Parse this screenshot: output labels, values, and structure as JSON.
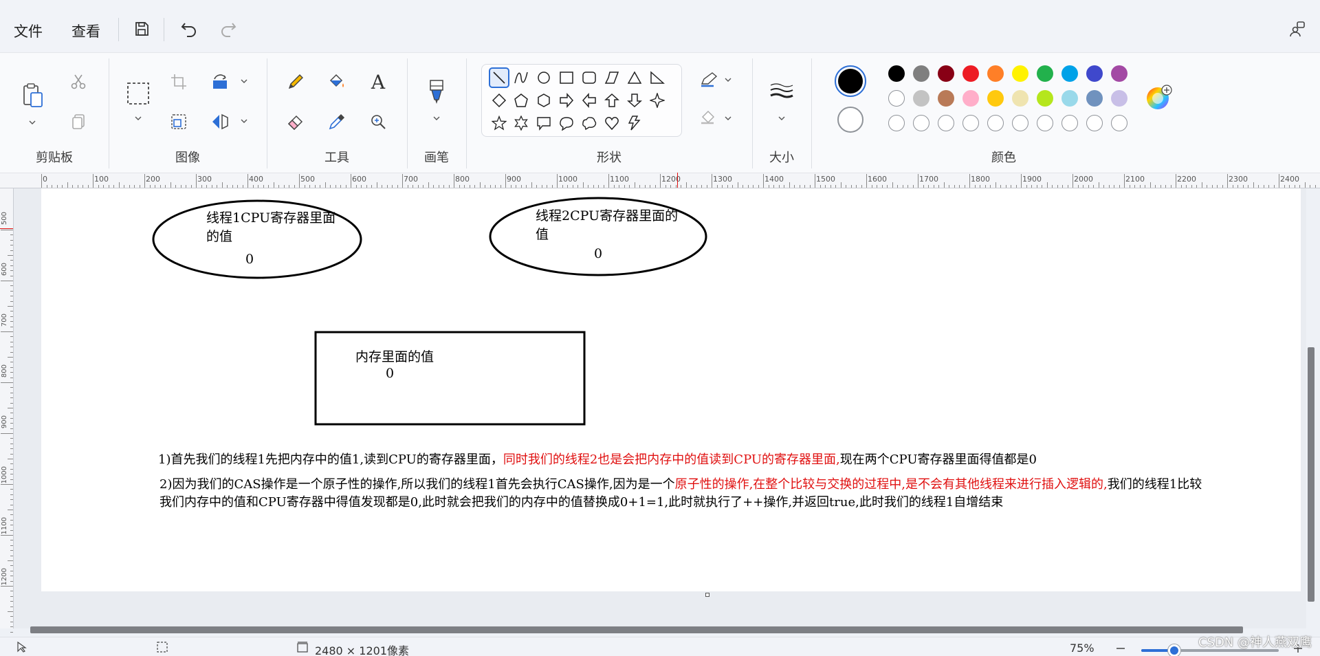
{
  "menu": {
    "file": "文件",
    "view": "查看"
  },
  "ribbon": {
    "groups": {
      "clipboard": "剪贴板",
      "image": "图像",
      "tools": "工具",
      "brushes": "画笔",
      "shapes": "形状",
      "size": "大小",
      "colors": "颜色"
    },
    "text_tool": "A",
    "active_color": "#000000",
    "secondary_color": "#ffffff",
    "palette_row1": [
      "#000000",
      "#7f7f7f",
      "#880015",
      "#ed1c24",
      "#ff7f27",
      "#fff200",
      "#22b14c",
      "#00a2e8",
      "#3f48cc",
      "#a349a4"
    ],
    "palette_row2": [
      "#ffffff",
      "#c3c3c3",
      "#b97a57",
      "#ffaec9",
      "#ffc90e",
      "#efe4b0",
      "#b5e61d",
      "#99d9ea",
      "#7092be",
      "#c8bfe7"
    ]
  },
  "ruler": {
    "ticks": [
      "0",
      "100",
      "200",
      "300",
      "400",
      "500",
      "600",
      "700",
      "800",
      "900",
      "1000",
      "1100",
      "1200",
      "1300",
      "1400",
      "1500",
      "1600",
      "1700",
      "1800",
      "1900",
      "2000",
      "2100",
      "2200",
      "2300",
      "2400"
    ],
    "vticks": [
      "500",
      "600",
      "700",
      "800",
      "900",
      "1000",
      "1100",
      "1200"
    ]
  },
  "canvas": {
    "ellipse1": {
      "title": "线程1CPU寄存器里面的值",
      "line1": "线程1CPU寄存器里面",
      "line2": "的值",
      "value": "0"
    },
    "ellipse2": {
      "line1": "线程2CPU寄存器里面的",
      "line2": "值",
      "value": "0"
    },
    "memory": {
      "title": "内存里面的值",
      "value": "0"
    },
    "para1": {
      "a": "1)首先我们的线程1先把内存中的值1,读到CPU的寄存器里面，",
      "b": "同时我们的线程2也是会把内存中的值读到CPU的寄存器里面,",
      "c": "现在两个CPU寄存器里面得值都是0"
    },
    "para2": {
      "a": "2)因为我们的CAS操作是一个原子性的操作,所以我们的线程1首先会执行CAS操作,因为是一个",
      "b": "原子性的操作,在整个比较与交换的过程中,是不会有其他线程来进行插入逻辑的,",
      "c": "我们的线程1比较我们内存中的值和CPU寄存器中得值发现都是0,此时就会把我们的内存中的值替换成0+1=1,此时就执行了++操作,并返回true,此时我们的线程1自增结束"
    }
  },
  "status": {
    "dimensions": "2480 × 1201像素",
    "zoom": "75%",
    "zoom_level": 0.24
  },
  "watermark": "CSDN @神人燕双鹰"
}
